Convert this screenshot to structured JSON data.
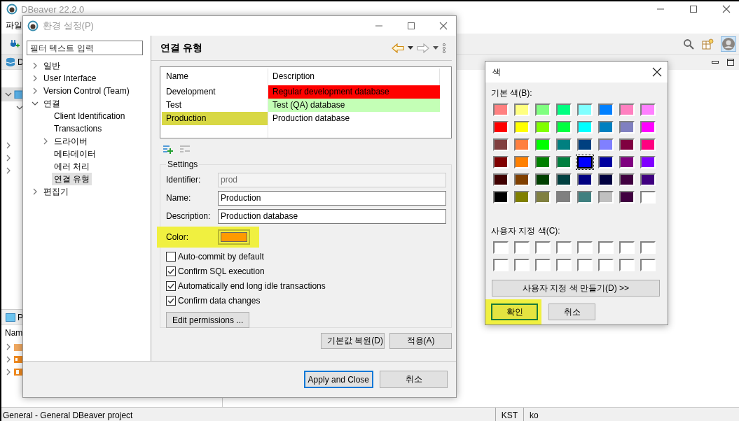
{
  "main_window": {
    "title": "DBeaver 22.2.0",
    "menu": [
      "파일"
    ],
    "navigator_tab": "D",
    "projects_tab": "P",
    "projects_column": "Nam",
    "status_bar": {
      "text": "General - General DBeaver project",
      "timezone": "KST",
      "locale": "ko"
    }
  },
  "preferences_dialog": {
    "title": "환경 설정(P)",
    "filter": {
      "placeholder": "필터 텍스트 입력"
    },
    "tree": [
      {
        "label": "일반",
        "kind": "group",
        "expanded": false,
        "selected": false
      },
      {
        "label": "User Interface",
        "kind": "group",
        "expanded": false,
        "selected": false
      },
      {
        "label": "Version Control (Team)",
        "kind": "group",
        "expanded": false,
        "selected": false
      },
      {
        "label": "연결",
        "kind": "group",
        "expanded": true,
        "selected": false,
        "children": [
          {
            "label": "Client Identification",
            "kind": "page",
            "selected": false
          },
          {
            "label": "Transactions",
            "kind": "page",
            "selected": false
          },
          {
            "label": "드라이버",
            "kind": "group",
            "expanded": false,
            "selected": false
          },
          {
            "label": "메타데이터",
            "kind": "page",
            "selected": false
          },
          {
            "label": "에러 처리",
            "kind": "page",
            "selected": false
          },
          {
            "label": "연결 유형",
            "kind": "page",
            "selected": true
          }
        ]
      },
      {
        "label": "편집기",
        "kind": "group",
        "expanded": false,
        "selected": false
      }
    ],
    "page": {
      "title": "연결 유형",
      "types": {
        "columns": [
          "Name",
          "Description"
        ],
        "rows": [
          {
            "name": "Development",
            "description": "Regular development database",
            "color": "#ff0000",
            "selected": false,
            "highlighted": false
          },
          {
            "name": "Test",
            "description": "Test (QA) database",
            "color": "#c4ffb6",
            "selected": false,
            "highlighted": false
          },
          {
            "name": "Production",
            "description": "Production database",
            "color": "#ffffff",
            "selected": true,
            "highlighted": true
          }
        ]
      },
      "settings": {
        "legend": "Settings",
        "identifier": {
          "label": "Identifier:",
          "value": "prod",
          "disabled": true
        },
        "name": {
          "label": "Name:",
          "value": "Production",
          "disabled": false
        },
        "description": {
          "label": "Description:",
          "value": "Production database",
          "disabled": false
        },
        "color": {
          "label": "Color:",
          "color": "#ff9a00",
          "highlighted": true
        },
        "options": [
          {
            "label": "Auto-commit by default",
            "checked": false
          },
          {
            "label": "Confirm SQL execution",
            "checked": true
          },
          {
            "label": "Automatically end long idle transactions",
            "checked": true
          },
          {
            "label": "Confirm data changes",
            "checked": true
          }
        ],
        "edit_permissions": "Edit permissions ..."
      },
      "buttons": [
        "기본값 복원(D)",
        "적용(A)"
      ]
    },
    "buttons": [
      {
        "label": "Apply and Close",
        "default": true
      },
      {
        "label": "취소",
        "default": false
      }
    ]
  },
  "color_dialog": {
    "title": "색",
    "basic_label": "기본 색(B):",
    "basic_colors": [
      {
        "color": "#ff8080",
        "selected": false
      },
      {
        "color": "#ffff80",
        "selected": false
      },
      {
        "color": "#80ff80",
        "selected": false
      },
      {
        "color": "#00ff80",
        "selected": false
      },
      {
        "color": "#80ffff",
        "selected": false
      },
      {
        "color": "#0080ff",
        "selected": false
      },
      {
        "color": "#ff80c0",
        "selected": false
      },
      {
        "color": "#ff80ff",
        "selected": false
      },
      {
        "color": "#ff0000",
        "selected": false
      },
      {
        "color": "#ffff00",
        "selected": false
      },
      {
        "color": "#80ff00",
        "selected": false
      },
      {
        "color": "#00ff40",
        "selected": false
      },
      {
        "color": "#00ffff",
        "selected": false
      },
      {
        "color": "#0080c0",
        "selected": false
      },
      {
        "color": "#8080c0",
        "selected": false
      },
      {
        "color": "#ff00ff",
        "selected": false
      },
      {
        "color": "#804040",
        "selected": false
      },
      {
        "color": "#ff8040",
        "selected": false
      },
      {
        "color": "#00ff00",
        "selected": false
      },
      {
        "color": "#008080",
        "selected": false
      },
      {
        "color": "#004080",
        "selected": false
      },
      {
        "color": "#8080ff",
        "selected": false
      },
      {
        "color": "#800040",
        "selected": false
      },
      {
        "color": "#ff0080",
        "selected": false
      },
      {
        "color": "#800000",
        "selected": false
      },
      {
        "color": "#ff8000",
        "selected": false
      },
      {
        "color": "#008000",
        "selected": false
      },
      {
        "color": "#008040",
        "selected": false
      },
      {
        "color": "#0000ff",
        "selected": true
      },
      {
        "color": "#0000a0",
        "selected": false
      },
      {
        "color": "#800080",
        "selected": false
      },
      {
        "color": "#8000ff",
        "selected": false
      },
      {
        "color": "#400000",
        "selected": false
      },
      {
        "color": "#804000",
        "selected": false
      },
      {
        "color": "#004000",
        "selected": false
      },
      {
        "color": "#004040",
        "selected": false
      },
      {
        "color": "#000080",
        "selected": false
      },
      {
        "color": "#000040",
        "selected": false
      },
      {
        "color": "#400040",
        "selected": false
      },
      {
        "color": "#400080",
        "selected": false
      },
      {
        "color": "#000000",
        "selected": false
      },
      {
        "color": "#808000",
        "selected": false
      },
      {
        "color": "#808040",
        "selected": false
      },
      {
        "color": "#808080",
        "selected": false
      },
      {
        "color": "#408080",
        "selected": false
      },
      {
        "color": "#c0c0c0",
        "selected": false
      },
      {
        "color": "#400040",
        "selected": false
      },
      {
        "color": "#ffffff",
        "selected": false
      }
    ],
    "custom_label": "사용자 지정 색(C):",
    "custom_colors": [
      {
        "color": "#ffffff"
      },
      {
        "color": "#ffffff"
      },
      {
        "color": "#ffffff"
      },
      {
        "color": "#ffffff"
      },
      {
        "color": "#ffffff"
      },
      {
        "color": "#ffffff"
      },
      {
        "color": "#ffffff"
      },
      {
        "color": "#ffffff"
      },
      {
        "color": "#ffffff"
      },
      {
        "color": "#ffffff"
      },
      {
        "color": "#ffffff"
      },
      {
        "color": "#ffffff"
      },
      {
        "color": "#ffffff"
      },
      {
        "color": "#ffffff"
      },
      {
        "color": "#ffffff"
      },
      {
        "color": "#ffffff"
      }
    ],
    "define_custom": "사용자 지정 색 만들기(D) >>",
    "buttons": [
      {
        "label": "확인",
        "default": true,
        "highlighted": true
      },
      {
        "label": "취소",
        "default": false,
        "highlighted": false
      }
    ]
  }
}
